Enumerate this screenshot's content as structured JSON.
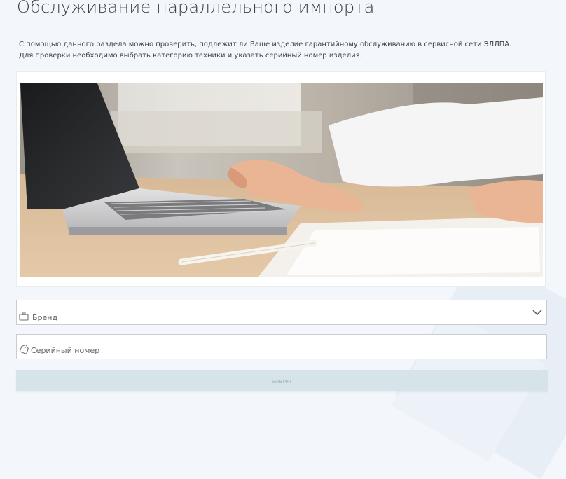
{
  "page": {
    "title": "Обслуживание параллельного импорта",
    "intro_line1": "С помощью данного раздела можно проверить, подлежит ли Ваше изделие гарантийному обслуживанию в сервисной сети ЭЛЛПА.",
    "intro_line2": "Для проверки необходимо выбрать категорию техники и указать серийный номер изделия."
  },
  "form": {
    "brand": {
      "placeholder": "Бренд",
      "icon": "briefcase-icon"
    },
    "serial": {
      "placeholder": "Серийный номер",
      "icon": "tag-icon"
    },
    "submit_label": "SUBMIT"
  },
  "colors": {
    "page_bg": "#f3f7fb",
    "submit_bg": "#d6e4ea",
    "submit_text": "#a3b3ba",
    "field_border": "#c9cdd2"
  }
}
